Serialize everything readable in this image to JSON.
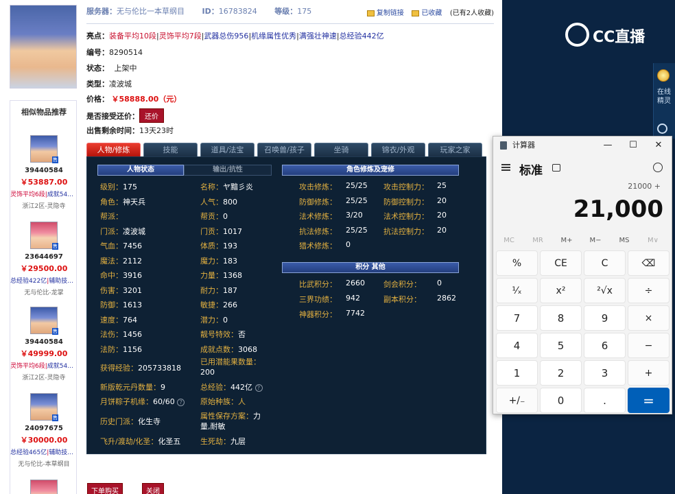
{
  "header": {
    "server_label": "服务器：",
    "server": "无与伦比一本草纲目",
    "id_label": "ID：",
    "id": "16783824",
    "level_label": "等级：",
    "level": "175",
    "copy_link": "复制链接",
    "favorited": "已收藏",
    "fav_count": "(已有2人收藏)"
  },
  "info": {
    "highlight_label": "亮点：",
    "highlights": [
      "装备平均10段",
      "灵饰平均7段",
      "武器总伤956",
      "机缘属性优秀",
      "满强壮神速",
      "总经验442亿"
    ],
    "number_label": "编号：",
    "number": "8290514",
    "status_label": "状态：",
    "status": "上架中",
    "type_label": "类型：",
    "type": "凌波城",
    "price_label": "价格：",
    "price": "￥58888.00（元）",
    "bargain_label": "是否接受还价：",
    "bargain_btn": "还价",
    "remaining_label": "出售剩余时间：",
    "remaining": "13天23时"
  },
  "tabs": [
    "人物/修炼",
    "技能",
    "道具/法宝",
    "召唤兽/孩子",
    "坐骑",
    "锦衣/外观",
    "玩家之家"
  ],
  "panel": {
    "char_status_tab": "人物状态",
    "resist_tab": "输出/抗性",
    "cultivation_head": "角色修炼及宠修",
    "points_head": "积分 其他",
    "left_col": [
      {
        "k": "级别：",
        "v": "175"
      },
      {
        "k": "角色：",
        "v": "神天兵"
      },
      {
        "k": "帮派：",
        "v": ""
      },
      {
        "k": "门派：",
        "v": "凌波城"
      },
      {
        "k": "气血：",
        "v": "7456"
      },
      {
        "k": "魔法：",
        "v": "2112"
      },
      {
        "k": "命中：",
        "v": "3916"
      },
      {
        "k": "伤害：",
        "v": "3201"
      },
      {
        "k": "防御：",
        "v": "1613"
      },
      {
        "k": "速度：",
        "v": "764"
      },
      {
        "k": "法伤：",
        "v": "1456"
      },
      {
        "k": "法防：",
        "v": "1156"
      }
    ],
    "mid_col": [
      {
        "k": "名称：",
        "v": "ヤ黯彡炎"
      },
      {
        "k": "人气：",
        "v": "800"
      },
      {
        "k": "帮贡：",
        "v": "0"
      },
      {
        "k": "门贡：",
        "v": "1017"
      },
      {
        "k": "体质：",
        "v": "193"
      },
      {
        "k": "魔力：",
        "v": "183"
      },
      {
        "k": "力量：",
        "v": "1368"
      },
      {
        "k": "耐力：",
        "v": "187"
      },
      {
        "k": "敏捷：",
        "v": "266"
      },
      {
        "k": "潜力：",
        "v": "0"
      },
      {
        "k": "靓号特效：",
        "v": "否"
      },
      {
        "k": "成就点数：",
        "v": "3068"
      }
    ],
    "lower_left": [
      {
        "k": "获得经验：",
        "v": "205733818"
      },
      {
        "k": "新版乾元丹数量：",
        "v": "9"
      },
      {
        "k": "月饼粽子机缘：",
        "v": "60/60"
      },
      {
        "k": "历史门派：",
        "v": "化生寺"
      },
      {
        "k": "飞升/渡劫/化圣：",
        "v": "化圣五"
      }
    ],
    "lower_mid": [
      {
        "k": "已用潜能果数量：",
        "v": "200"
      },
      {
        "k": "总经验：",
        "v": "442亿"
      },
      {
        "k": "原始种族：",
        "v": "人"
      },
      {
        "k": "属性保存方案：",
        "v": "力量,耐敏"
      },
      {
        "k": "生死劫：",
        "v": "九层"
      }
    ],
    "cult_left": [
      {
        "k": "攻击修炼：",
        "v": "25/25"
      },
      {
        "k": "防御修炼：",
        "v": "25/25"
      },
      {
        "k": "法术修炼：",
        "v": "3/20"
      },
      {
        "k": "抗法修炼：",
        "v": "25/25"
      },
      {
        "k": "猎术修炼：",
        "v": "0"
      }
    ],
    "cult_right": [
      {
        "k": "攻击控制力：",
        "v": "25"
      },
      {
        "k": "防御控制力：",
        "v": "20"
      },
      {
        "k": "法术控制力：",
        "v": "20"
      },
      {
        "k": "抗法控制力：",
        "v": "20"
      }
    ],
    "points_left": [
      {
        "k": "比武积分：",
        "v": "2660"
      },
      {
        "k": "三界功绩：",
        "v": "942"
      },
      {
        "k": "神器积分：",
        "v": "7742"
      }
    ],
    "points_right": [
      {
        "k": "剑会积分：",
        "v": "0"
      },
      {
        "k": "副本积分：",
        "v": "2862"
      }
    ]
  },
  "bottom": {
    "buy": "下单购买",
    "close": "关闭"
  },
  "sidebar": {
    "title": "相似物品推荐",
    "badge": "售",
    "items": [
      {
        "id": "39440584",
        "price": "￥53887.00",
        "tag_a": "灵饰平均6段",
        "tag_b": "成就54...",
        "server": "浙江2区-灵隐寺",
        "style": "blue"
      },
      {
        "id": "23644697",
        "price": "￥29500.00",
        "tag_a": "总经验422亿",
        "tag_b": "辅助技...",
        "server": "无与伦比-龙掌",
        "style": "blue"
      },
      {
        "id": "39440584",
        "price": "￥49999.00",
        "tag_a": "灵饰平均6段",
        "tag_b": "成就54...",
        "server": "浙江2区-灵隐寺",
        "style": "blue"
      },
      {
        "id": "24097675",
        "price": "￥30000.00",
        "tag_a": "总经验465亿",
        "tag_b": "辅助技...",
        "server": "无与伦比-本草纲目",
        "style": "blue"
      }
    ]
  },
  "stream": {
    "logo": "CC直播",
    "side_label": "在线精灵"
  },
  "calc": {
    "title": "计算器",
    "mode": "标准",
    "expression": "21000 +",
    "display": "21,000",
    "memory": [
      "MC",
      "MR",
      "M+",
      "M−",
      "MS",
      "M∨"
    ],
    "keys": [
      "%",
      "CE",
      "C",
      "⌫",
      "¹⁄ₓ",
      "x²",
      "²√x",
      "÷",
      "7",
      "8",
      "9",
      "×",
      "4",
      "5",
      "6",
      "−",
      "1",
      "2",
      "3",
      "+",
      "+/₋",
      "0",
      ".",
      "="
    ]
  },
  "colors": {
    "panel_bg": "#0e2134",
    "label_gold": "#e2b040",
    "active_tab": "#d52a1e",
    "equals_blue": "#005fb8",
    "price_red": "#dd1111"
  }
}
